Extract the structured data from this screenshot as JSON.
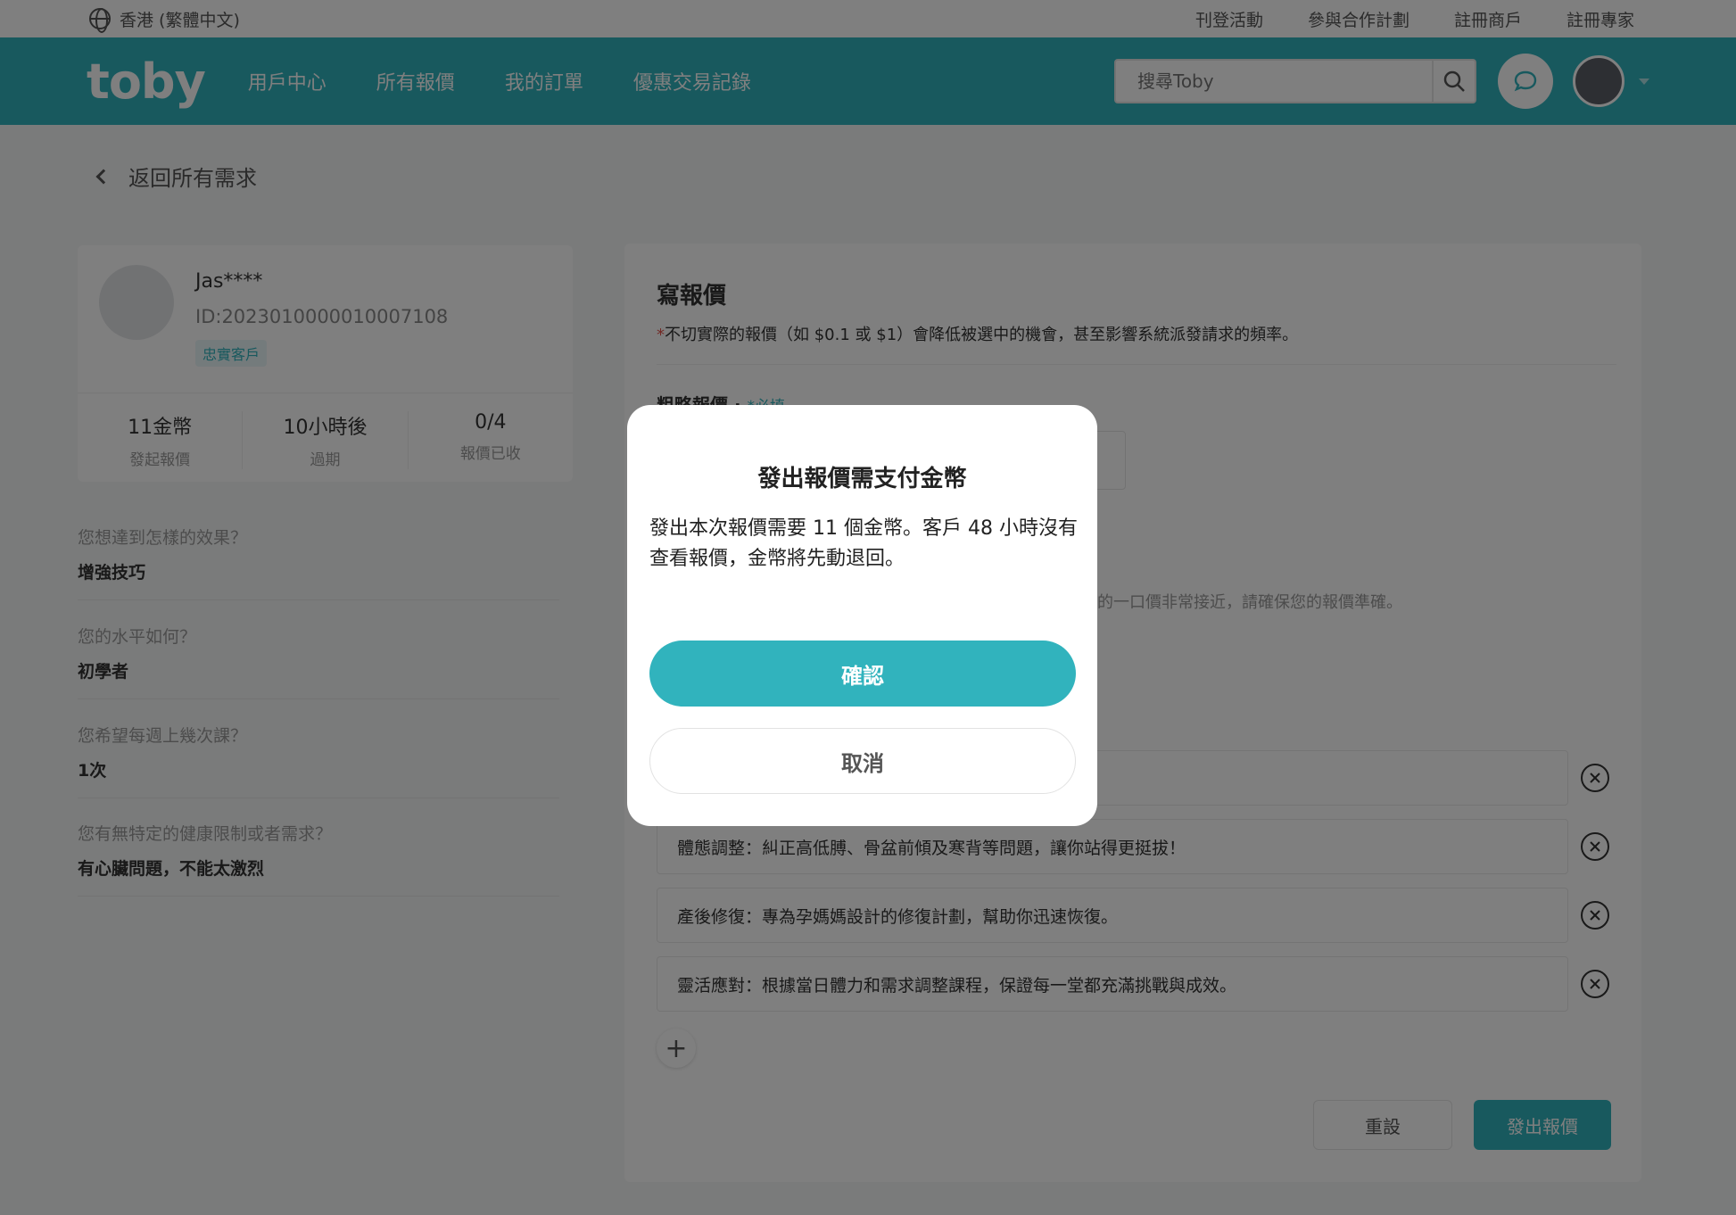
{
  "topbar": {
    "locale": "香港 (繁體中文)",
    "links": [
      "刊登活動",
      "參與合作計劃",
      "註冊商戶",
      "註冊專家"
    ]
  },
  "nav": {
    "logo": "toby",
    "menu": [
      "用戶中心",
      "所有報價",
      "我的訂單",
      "優惠交易記錄"
    ],
    "search_placeholder": "搜尋Toby",
    "brand_color": "#31b3bd"
  },
  "back": {
    "label": "返回所有需求"
  },
  "customer": {
    "name": "Jas****",
    "id": "ID:2023010000010007108",
    "badge": "忠實客戶",
    "stats": [
      {
        "value": "11金幣",
        "label": "發起報價"
      },
      {
        "value": "10小時後",
        "label": "過期"
      },
      {
        "value": "0/4",
        "label": "報價已收"
      }
    ]
  },
  "questions": [
    {
      "q": "您想達到怎樣的效果？",
      "a": "增強技巧"
    },
    {
      "q": "您的水平如何？",
      "a": "初學者"
    },
    {
      "q": "您希望每週上幾次課？",
      "a": "1次"
    },
    {
      "q": "您有無特定的健康限制或者需求？",
      "a": "有心臟問題，不能太激烈"
    }
  ],
  "quote": {
    "title": "寫報價",
    "note_star": "*",
    "note": "不切實際的報價（如 $0.1 或 $1）會降低被選中的機會，甚至影響系統派發請求的頻率。",
    "price_label": "粗略報價",
    "price_required": "*必填",
    "hint": "的一口價非常接近，請確保您的報價準確。",
    "features": [
      "",
      "體態調整：糾正高低膊、骨盆前傾及寒背等問題，讓你站得更挺拔！",
      "產後修復：專為孕媽媽設計的修復計劃，幫助你迅速恢復。",
      "靈活應對：根據當日體力和需求調整課程，保證每一堂都充滿挑戰與成效。"
    ],
    "reset_label": "重設",
    "send_label": "發出報價"
  },
  "modal": {
    "title": "發出報價需支付金幣",
    "body": "發出本次報價需要 11 個金幣。客戶 48 小時沒有查看報價，金幣將先動退回。",
    "confirm": "確認",
    "cancel": "取消"
  }
}
